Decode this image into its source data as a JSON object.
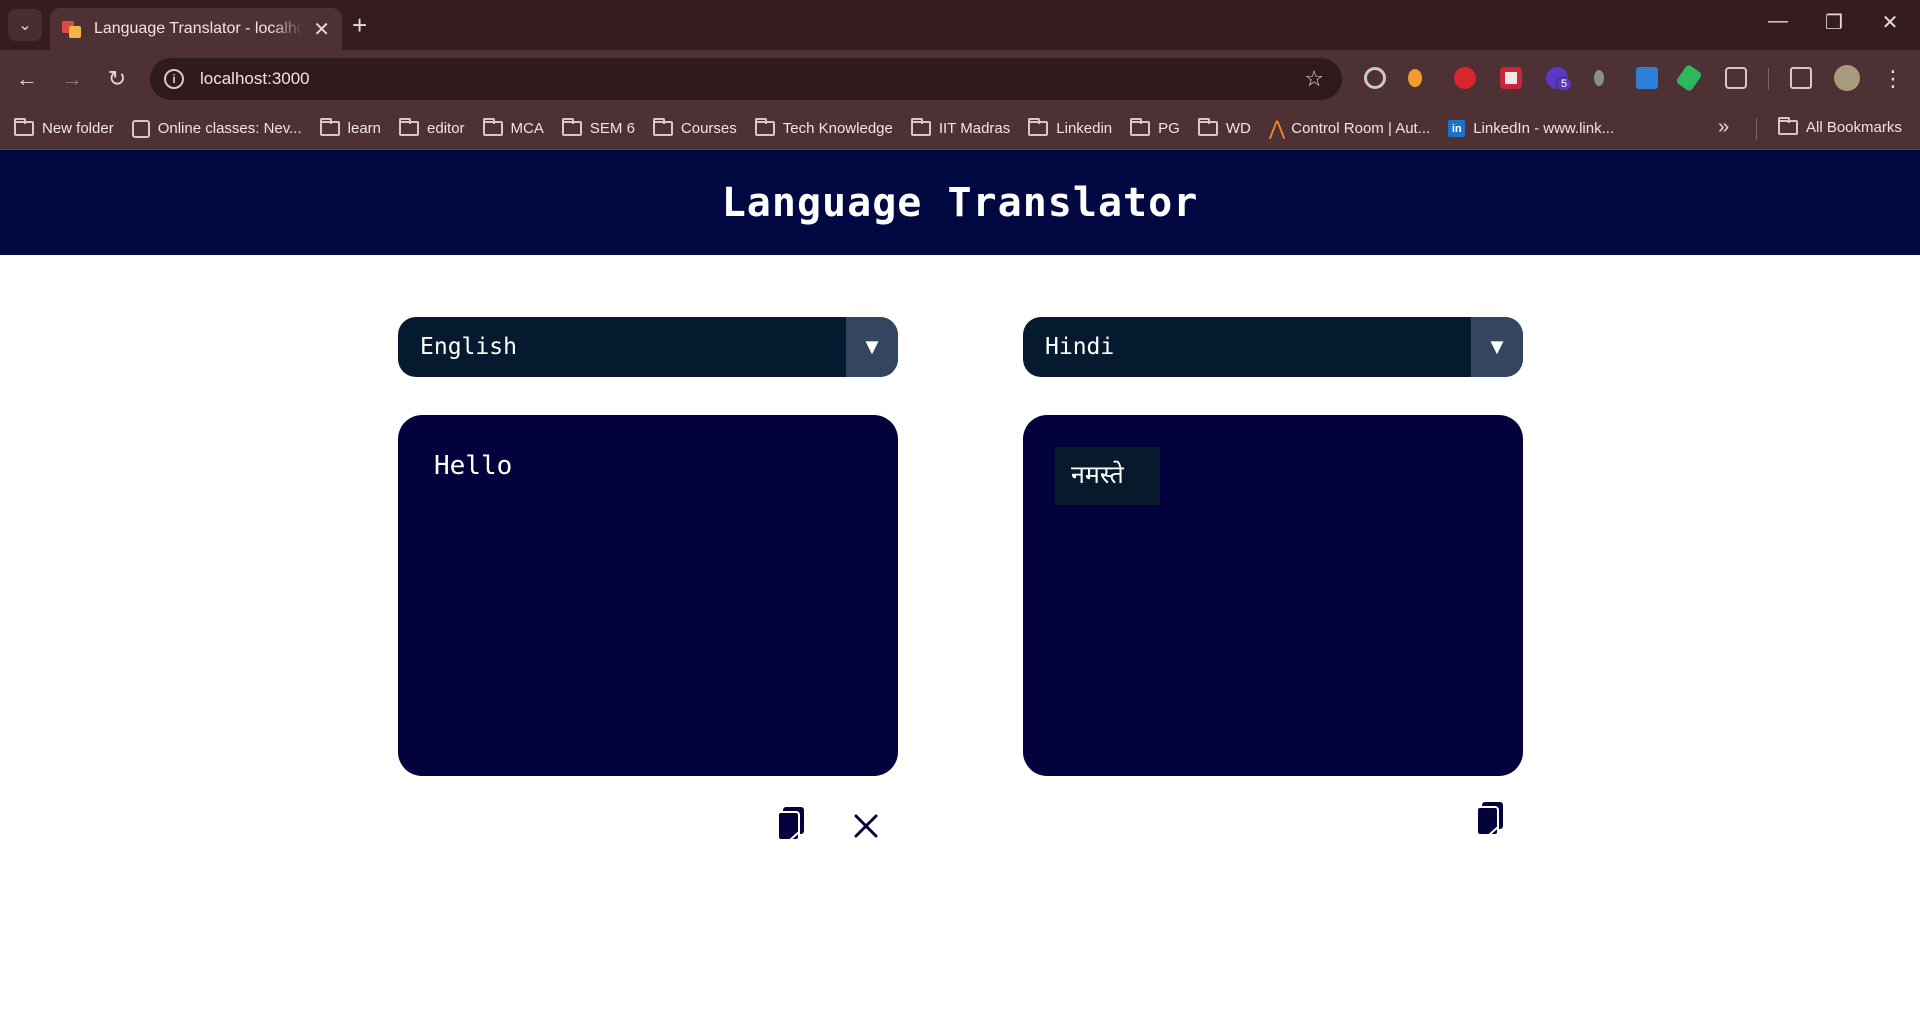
{
  "browser": {
    "tab_title": "Language Translator - localhost",
    "url": "localhost:3000",
    "bookmarks": [
      {
        "label": "New folder",
        "icon": "folder-icon"
      },
      {
        "label": "Online classes: Nev...",
        "icon": "page-icon"
      },
      {
        "label": "learn",
        "icon": "folder-icon"
      },
      {
        "label": "editor",
        "icon": "folder-icon"
      },
      {
        "label": "MCA",
        "icon": "folder-icon"
      },
      {
        "label": "SEM 6",
        "icon": "folder-icon"
      },
      {
        "label": "Courses",
        "icon": "folder-icon"
      },
      {
        "label": "Tech Knowledge",
        "icon": "folder-icon"
      },
      {
        "label": "IIT Madras",
        "icon": "folder-icon"
      },
      {
        "label": "Linkedin",
        "icon": "folder-icon"
      },
      {
        "label": "PG",
        "icon": "folder-icon"
      },
      {
        "label": "WD",
        "icon": "folder-icon"
      },
      {
        "label": "Control Room | Aut...",
        "icon": "automation-anywhere-icon"
      },
      {
        "label": "LinkedIn - www.link...",
        "icon": "linkedin-icon"
      }
    ],
    "all_bookmarks_label": "All Bookmarks",
    "extension_badge": "5"
  },
  "app": {
    "title": "Language Translator",
    "source": {
      "language": "English",
      "text": "Hello"
    },
    "target": {
      "language": "Hindi",
      "text": "नमस्ते"
    }
  },
  "colors": {
    "header_bg": "#020842",
    "box_bg": "#03023d",
    "select_bg": "#051a2e",
    "select_arrow_bg": "#34465f",
    "icon_color": "#03023d"
  }
}
